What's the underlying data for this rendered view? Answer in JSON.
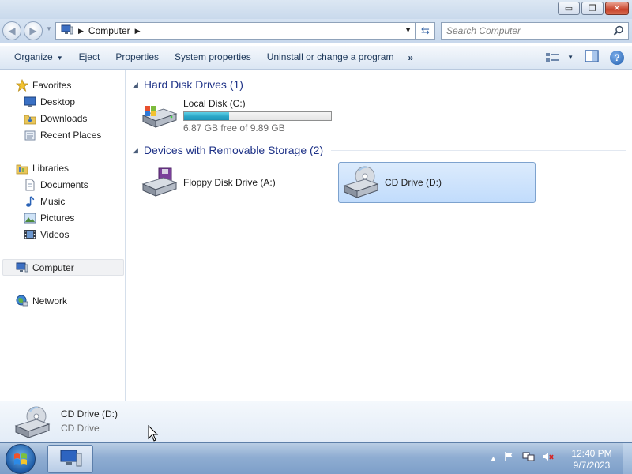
{
  "window": {
    "minimize": "▭",
    "maximize": "❐",
    "close": "✕"
  },
  "address_bar": {
    "crumbs": [
      "Computer"
    ],
    "search_placeholder": "Search Computer"
  },
  "toolbar": {
    "organize": "Organize",
    "eject": "Eject",
    "properties": "Properties",
    "system_properties": "System properties",
    "uninstall": "Uninstall or change a program",
    "more": "»"
  },
  "sidebar": {
    "favorites": "Favorites",
    "desktop": "Desktop",
    "downloads": "Downloads",
    "recent_places": "Recent Places",
    "libraries": "Libraries",
    "documents": "Documents",
    "music": "Music",
    "pictures": "Pictures",
    "videos": "Videos",
    "computer": "Computer",
    "network": "Network"
  },
  "groups": {
    "hard_disks": {
      "title": "Hard Disk Drives (1)",
      "drives": [
        {
          "name": "Local Disk (C:)",
          "free_text": "6.87 GB free of 9.89 GB",
          "used_fraction": 0.305
        }
      ]
    },
    "removable": {
      "title": "Devices with Removable Storage (2)",
      "drives": [
        {
          "name": "Floppy Disk Drive (A:)"
        },
        {
          "name": "CD Drive (D:)",
          "selected": true
        }
      ]
    }
  },
  "details": {
    "name": "CD Drive (D:)",
    "type": "CD Drive"
  },
  "taskbar": {
    "time": "12:40 PM",
    "date": "9/7/2023"
  },
  "icons": {
    "favorites": "star-icon",
    "desktop": "desktop-icon",
    "downloads": "downloads-folder-icon",
    "recent_places": "recent-places-icon",
    "libraries": "libraries-icon",
    "documents": "documents-icon",
    "music": "music-note-icon",
    "pictures": "pictures-icon",
    "videos": "film-icon",
    "computer": "computer-icon",
    "network": "network-globe-icon"
  },
  "colors": {
    "group_title": "#1e3287",
    "disk_bar": "#2aa6c7",
    "selection": "#c1dcfc"
  }
}
